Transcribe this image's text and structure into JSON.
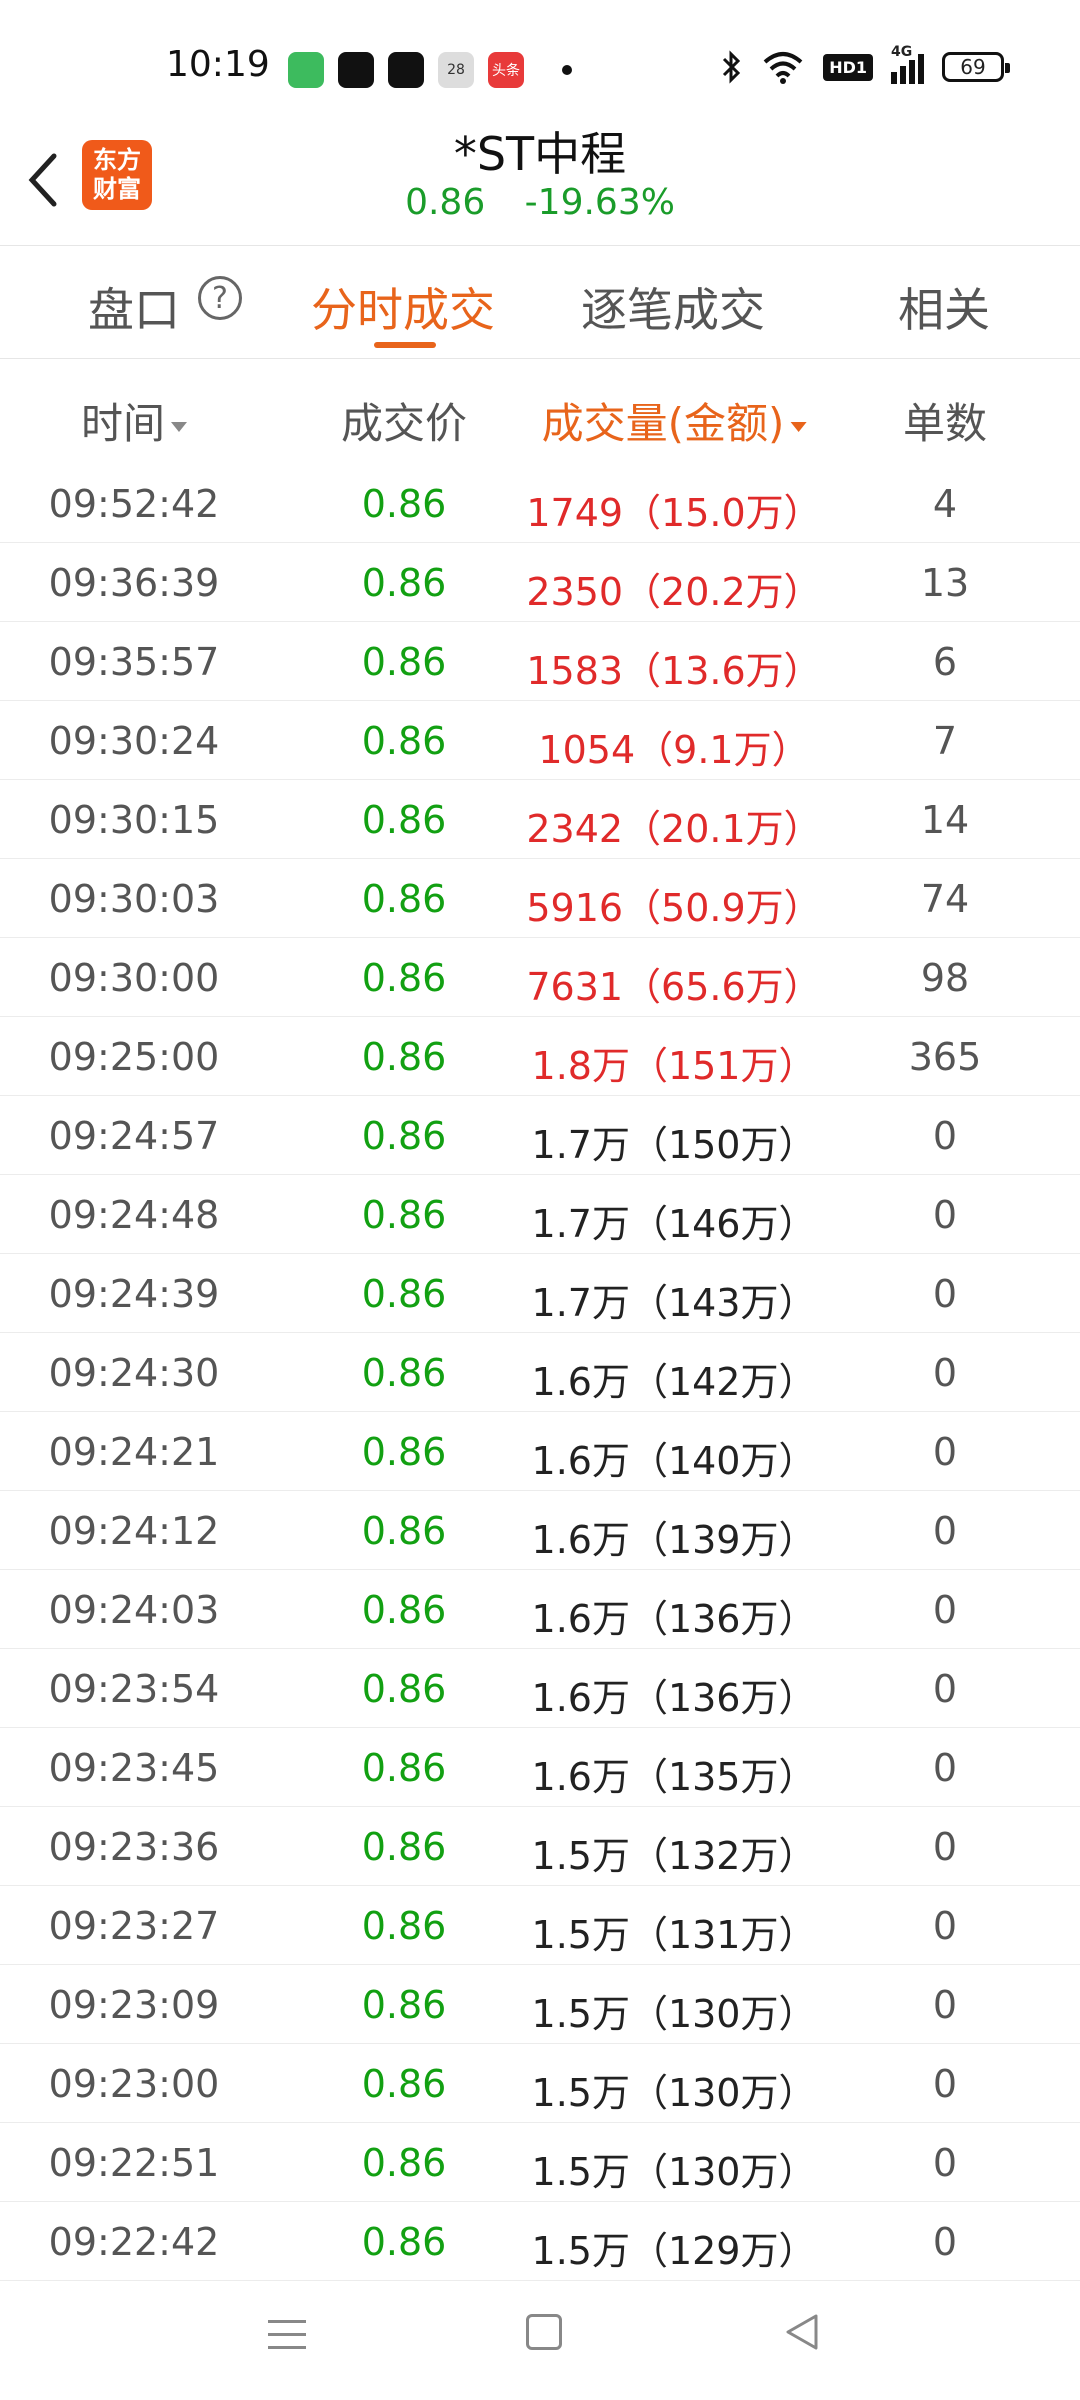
{
  "status_bar": {
    "time": "10:19",
    "apps": [
      {
        "icon": "message-app-icon",
        "color": "#3dbb5e",
        "label": ""
      },
      {
        "icon": "wechat-icon",
        "color": "#111111",
        "label": ""
      },
      {
        "icon": "tiktok-icon",
        "color": "#111111",
        "label": ""
      },
      {
        "icon": "calendar-icon",
        "color": "#dddddd",
        "label": "28"
      },
      {
        "icon": "toutiao-icon",
        "color": "#e83a3a",
        "label": "头条"
      }
    ],
    "network_badge": "HD1",
    "signal_label": "4G",
    "battery": "69"
  },
  "header": {
    "logo_line1": "东方",
    "logo_line2": "财富",
    "stock_name": "*ST中程",
    "price": "0.86",
    "change_pct": "-19.63%",
    "price_color": "#1a9c2a"
  },
  "tabs": [
    {
      "label": "盘口",
      "active": false
    },
    {
      "label": "分时成交",
      "active": true
    },
    {
      "label": "逐笔成交",
      "active": false
    },
    {
      "label": "相关",
      "active": false
    }
  ],
  "help_glyph": "?",
  "table": {
    "headers": {
      "time": "时间",
      "price": "成交价",
      "volume": "成交量(金额)",
      "count": "单数"
    },
    "rows": [
      {
        "time": "09:52:42",
        "price": "0.86",
        "volume": "1749（15.0万）",
        "count": "4",
        "highlight": true
      },
      {
        "time": "09:36:39",
        "price": "0.86",
        "volume": "2350（20.2万）",
        "count": "13",
        "highlight": true
      },
      {
        "time": "09:35:57",
        "price": "0.86",
        "volume": "1583（13.6万）",
        "count": "6",
        "highlight": true
      },
      {
        "time": "09:30:24",
        "price": "0.86",
        "volume": "1054（9.1万）",
        "count": "7",
        "highlight": true
      },
      {
        "time": "09:30:15",
        "price": "0.86",
        "volume": "2342（20.1万）",
        "count": "14",
        "highlight": true
      },
      {
        "time": "09:30:03",
        "price": "0.86",
        "volume": "5916（50.9万）",
        "count": "74",
        "highlight": true
      },
      {
        "time": "09:30:00",
        "price": "0.86",
        "volume": "7631（65.6万）",
        "count": "98",
        "highlight": true
      },
      {
        "time": "09:25:00",
        "price": "0.86",
        "volume": "1.8万（151万）",
        "count": "365",
        "highlight": true
      },
      {
        "time": "09:24:57",
        "price": "0.86",
        "volume": "1.7万（150万）",
        "count": "0",
        "highlight": false
      },
      {
        "time": "09:24:48",
        "price": "0.86",
        "volume": "1.7万（146万）",
        "count": "0",
        "highlight": false
      },
      {
        "time": "09:24:39",
        "price": "0.86",
        "volume": "1.7万（143万）",
        "count": "0",
        "highlight": false
      },
      {
        "time": "09:24:30",
        "price": "0.86",
        "volume": "1.6万（142万）",
        "count": "0",
        "highlight": false
      },
      {
        "time": "09:24:21",
        "price": "0.86",
        "volume": "1.6万（140万）",
        "count": "0",
        "highlight": false
      },
      {
        "time": "09:24:12",
        "price": "0.86",
        "volume": "1.6万（139万）",
        "count": "0",
        "highlight": false
      },
      {
        "time": "09:24:03",
        "price": "0.86",
        "volume": "1.6万（136万）",
        "count": "0",
        "highlight": false
      },
      {
        "time": "09:23:54",
        "price": "0.86",
        "volume": "1.6万（136万）",
        "count": "0",
        "highlight": false
      },
      {
        "time": "09:23:45",
        "price": "0.86",
        "volume": "1.6万（135万）",
        "count": "0",
        "highlight": false
      },
      {
        "time": "09:23:36",
        "price": "0.86",
        "volume": "1.5万（132万）",
        "count": "0",
        "highlight": false
      },
      {
        "time": "09:23:27",
        "price": "0.86",
        "volume": "1.5万（131万）",
        "count": "0",
        "highlight": false
      },
      {
        "time": "09:23:09",
        "price": "0.86",
        "volume": "1.5万（130万）",
        "count": "0",
        "highlight": false
      },
      {
        "time": "09:23:00",
        "price": "0.86",
        "volume": "1.5万（130万）",
        "count": "0",
        "highlight": false
      },
      {
        "time": "09:22:51",
        "price": "0.86",
        "volume": "1.5万（130万）",
        "count": "0",
        "highlight": false
      },
      {
        "time": "09:22:42",
        "price": "0.86",
        "volume": "1.5万（129万）",
        "count": "0",
        "highlight": false
      }
    ]
  },
  "colors": {
    "accent": "#e8641b",
    "price_green": "#12a012",
    "volume_red": "#e02a2a",
    "brand_orange": "#f05a1a"
  }
}
